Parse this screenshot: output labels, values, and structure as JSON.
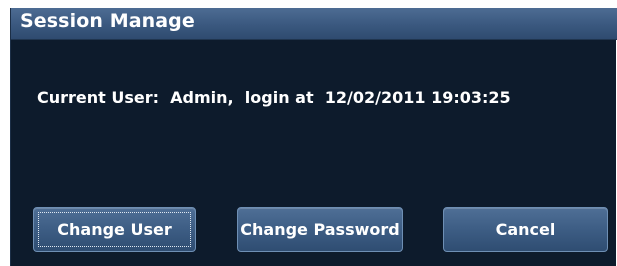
{
  "dialog": {
    "title": "Session Manage",
    "current_user_label": "Current User:",
    "current_user": "Admin,",
    "login_label": "login at",
    "login_time": "12/02/2011 19:03:25"
  },
  "buttons": {
    "change_user": "Change User",
    "change_password": "Change Password",
    "cancel": "Cancel"
  },
  "focused_button": "change_user",
  "colors": {
    "background": "#0d1b2c",
    "titlebar": "#3a587f",
    "button": "#3d5d84",
    "text": "#ffffff"
  }
}
